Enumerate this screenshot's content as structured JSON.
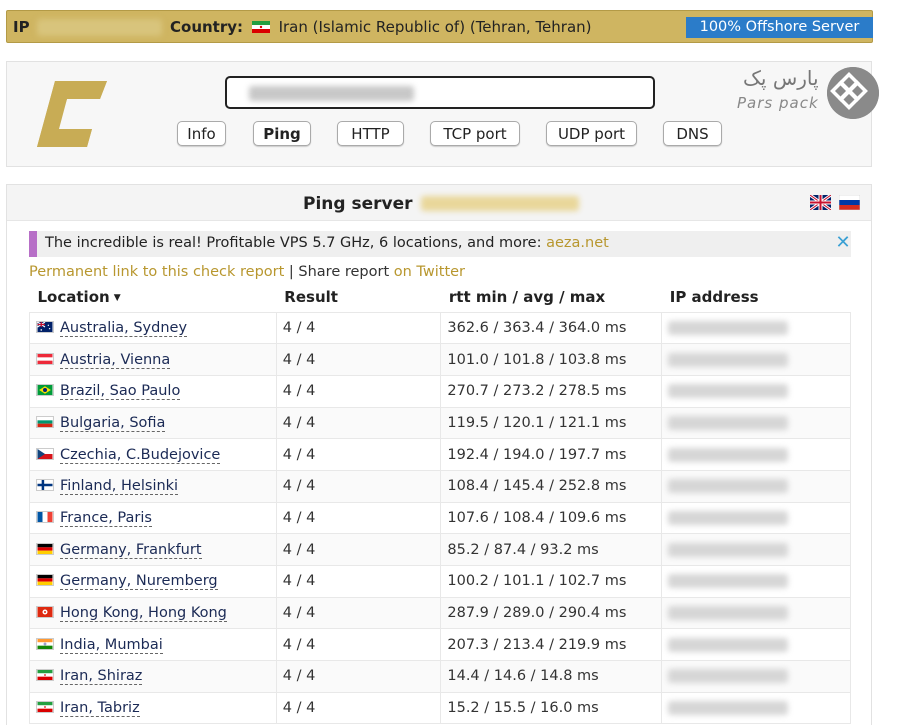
{
  "topbar": {
    "ip_label": "IP",
    "country_label": "Country:",
    "country_value": "Iran (Islamic Republic of) (Tehran, Tehran)",
    "offshore_label": "100% Offshore Server"
  },
  "header": {
    "tabs": [
      {
        "label": "Info",
        "active": false
      },
      {
        "label": "Ping",
        "active": true
      },
      {
        "label": "HTTP",
        "active": false
      },
      {
        "label": "TCP port",
        "active": false
      },
      {
        "label": "UDP port",
        "active": false
      },
      {
        "label": "DNS",
        "active": false
      }
    ],
    "brand_fa": "پارس پک",
    "brand_en": "Pars pack"
  },
  "result": {
    "title": "Ping server",
    "ad": {
      "text": "The incredible is real! Profitable VPS 5.7 GHz, 6 locations, and more: ",
      "link": "aeza.net",
      "close": "✕"
    },
    "links": {
      "permanent": "Permanent link to this check report",
      "separator": " | Share report ",
      "twitter": "on Twitter"
    },
    "columns": {
      "location": "Location",
      "result": "Result",
      "rtt": "rtt min / avg / max",
      "ip": "IP address"
    },
    "rows": [
      {
        "location": "Australia, Sydney",
        "flag": "au",
        "result": "4 / 4",
        "rtt": "362.6 / 363.4 / 364.0 ms"
      },
      {
        "location": "Austria, Vienna",
        "flag": "at",
        "result": "4 / 4",
        "rtt": "101.0 / 101.8 / 103.8 ms"
      },
      {
        "location": "Brazil, Sao Paulo",
        "flag": "br",
        "result": "4 / 4",
        "rtt": "270.7 / 273.2 / 278.5 ms"
      },
      {
        "location": "Bulgaria, Sofia",
        "flag": "bg",
        "result": "4 / 4",
        "rtt": "119.5 / 120.1 / 121.1 ms"
      },
      {
        "location": "Czechia, C.Budejovice",
        "flag": "cz",
        "result": "4 / 4",
        "rtt": "192.4 / 194.0 / 197.7 ms"
      },
      {
        "location": "Finland, Helsinki",
        "flag": "fi",
        "result": "4 / 4",
        "rtt": "108.4 / 145.4 / 252.8 ms"
      },
      {
        "location": "France, Paris",
        "flag": "fr",
        "result": "4 / 4",
        "rtt": "107.6 / 108.4 / 109.6 ms"
      },
      {
        "location": "Germany, Frankfurt",
        "flag": "de",
        "result": "4 / 4",
        "rtt": "85.2 / 87.4 / 93.2 ms"
      },
      {
        "location": "Germany, Nuremberg",
        "flag": "de",
        "result": "4 / 4",
        "rtt": "100.2 / 101.1 / 102.7 ms"
      },
      {
        "location": "Hong Kong, Hong Kong",
        "flag": "hk",
        "result": "4 / 4",
        "rtt": "287.9 / 289.0 / 290.4 ms"
      },
      {
        "location": "India, Mumbai",
        "flag": "in",
        "result": "4 / 4",
        "rtt": "207.3 / 213.4 / 219.9 ms"
      },
      {
        "location": "Iran, Shiraz",
        "flag": "ir",
        "result": "4 / 4",
        "rtt": "14.4 / 14.6 / 14.8 ms"
      },
      {
        "location": "Iran, Tabriz",
        "flag": "ir",
        "result": "4 / 4",
        "rtt": "15.2 / 15.5 / 16.0 ms"
      }
    ]
  },
  "colors": {
    "topbar_bg": "#cfb561",
    "offshore_bg": "#2b7cc9",
    "link_gold": "#b8972f",
    "ad_accent": "#b76fc7",
    "location_link": "#1b2a55"
  }
}
